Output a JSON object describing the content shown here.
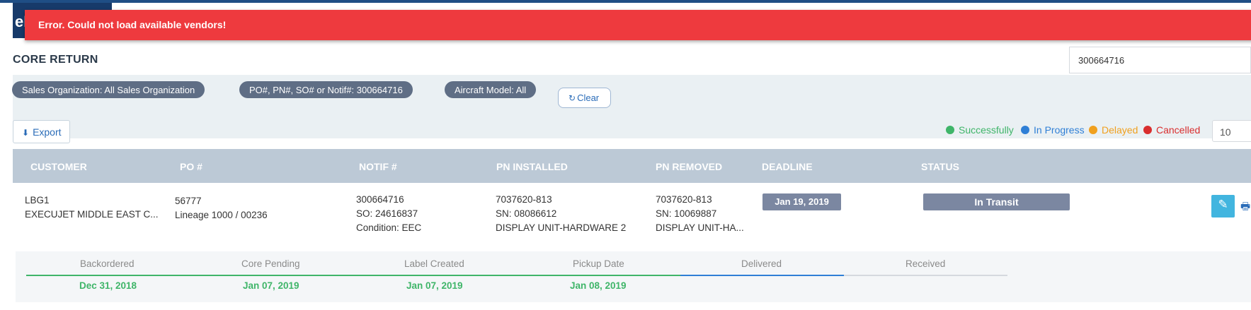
{
  "app": {
    "logo_text": "eF"
  },
  "alert": {
    "message": "Error. Could not load available vendors!"
  },
  "page": {
    "title": "CORE RETURN"
  },
  "search": {
    "value": "300664716"
  },
  "filters": {
    "chips": [
      "Sales Organization: All Sales Organization",
      "PO#, PN#, SO# or Notif#: 300664716",
      "Aircraft Model: All"
    ],
    "clear_label": "Clear"
  },
  "toolbar": {
    "export_label": "Export",
    "page_size": "10"
  },
  "legend": [
    {
      "label": "Successfully",
      "color": "#3fb569"
    },
    {
      "label": "In Progress",
      "color": "#2f7fd6"
    },
    {
      "label": "Delayed",
      "color": "#f0a01e"
    },
    {
      "label": "Cancelled",
      "color": "#d92e2e"
    }
  ],
  "table": {
    "columns": [
      "CUSTOMER",
      "PO #",
      "NOTIF #",
      "PN INSTALLED",
      "PN REMOVED",
      "DEADLINE",
      "STATUS"
    ],
    "rows": [
      {
        "customer": [
          "LBG1",
          "EXECUJET MIDDLE EAST C..."
        ],
        "po": [
          "56777",
          "Lineage 1000 / 00236"
        ],
        "notif": [
          "300664716",
          "SO: 24616837",
          "Condition: EEC"
        ],
        "pn_installed": [
          "7037620-813",
          "SN: 08086612",
          "DISPLAY UNIT-HARDWARE 2"
        ],
        "pn_removed": [
          "7037620-813",
          "SN: 10069887",
          "DISPLAY UNIT-HA..."
        ],
        "deadline": "Jan 19, 2019",
        "status": "In Transit"
      }
    ]
  },
  "tracker": {
    "steps": [
      {
        "label": "Backordered",
        "date": "Dec 31, 2018",
        "line_color": "#3fb569"
      },
      {
        "label": "Core Pending",
        "date": "Jan 07, 2019",
        "line_color": "#3fb569"
      },
      {
        "label": "Label Created",
        "date": "Jan 07, 2019",
        "line_color": "#3fb569"
      },
      {
        "label": "Pickup Date",
        "date": "Jan 08, 2019",
        "line_color": "#3fb569"
      },
      {
        "label": "Delivered",
        "date": "",
        "line_color": "#2f7fd6"
      },
      {
        "label": "Received",
        "date": "",
        "line_color": "#d5d9de"
      }
    ]
  }
}
